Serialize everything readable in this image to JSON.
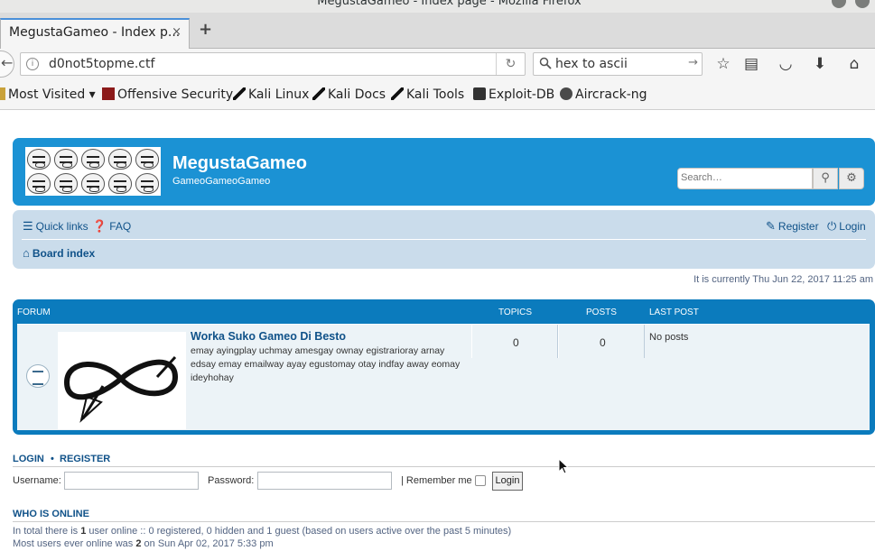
{
  "window": {
    "title": "MegustaGameo - Index page - Mozilla Firefox"
  },
  "tab": {
    "title": "MegustaGameo - Index p...",
    "close": "×",
    "new": "+"
  },
  "urlbar": {
    "url": "d0not5topme.ctf",
    "info": "i",
    "reload": "↻"
  },
  "searchbar": {
    "value": "hex to ascii",
    "go": "→"
  },
  "toolbar_icons": {
    "bookmark": "☆",
    "reading_list": "▤",
    "pocket": "◡",
    "downloads": "⬇",
    "home": "⌂"
  },
  "bookmarks": [
    {
      "label": "Most Visited ▾",
      "icon": "gear-icon"
    },
    {
      "label": "Offensive Security",
      "icon": "offsec-icon"
    },
    {
      "label": "Kali Linux",
      "icon": "kali-icon"
    },
    {
      "label": "Kali Docs",
      "icon": "kali-icon"
    },
    {
      "label": "Kali Tools",
      "icon": "kali-icon"
    },
    {
      "label": "Exploit-DB",
      "icon": "exploitdb-icon"
    },
    {
      "label": "Aircrack-ng",
      "icon": "aircrack-icon"
    }
  ],
  "site": {
    "name": "MegustaGameo",
    "description": "GameoGameoGameo",
    "search_placeholder": "Search…",
    "search_icon": "⚲",
    "advanced_icon": "⚙"
  },
  "nav": {
    "quick_links": "Quick links",
    "faq": "FAQ",
    "register": "Register",
    "login": "Login",
    "board_index": "Board index"
  },
  "current_time": "It is currently Thu Jun 22, 2017 11:25 am",
  "forum_table": {
    "headers": {
      "forum": "FORUM",
      "topics": "TOPICS",
      "posts": "POSTS",
      "last_post": "LAST POST"
    },
    "rows": [
      {
        "title": "Worka Suko Gameo Di Besto",
        "description": "emay ayingplay uchmay amesgay ownay egistrarioray arnay edsay emay emailway ayay egustomay otay indfay away eomay ideyhohay",
        "topics": "0",
        "posts": "0",
        "last_post": "No posts"
      }
    ]
  },
  "login_section": {
    "login": "LOGIN",
    "separator": "•",
    "register": "REGISTER",
    "username_label": "Username:",
    "password_label": "Password:",
    "remember_label": "| Remember me",
    "button": "Login"
  },
  "who_is_online": {
    "heading": "WHO IS ONLINE",
    "line1_pre": "In total there is ",
    "line1_count": "1",
    "line1_post": " user online :: 0 registered, 0 hidden and 1 guest (based on users active over the past 5 minutes)",
    "line2_pre": "Most users ever online was ",
    "line2_count": "2",
    "line2_post": " on Sun Apr 02, 2017 5:33 pm"
  },
  "colors": {
    "header_blue": "#1b92d4",
    "nav_panel": "#cadceb",
    "forum_box": "#0b7bbd",
    "link_blue": "#105289"
  }
}
